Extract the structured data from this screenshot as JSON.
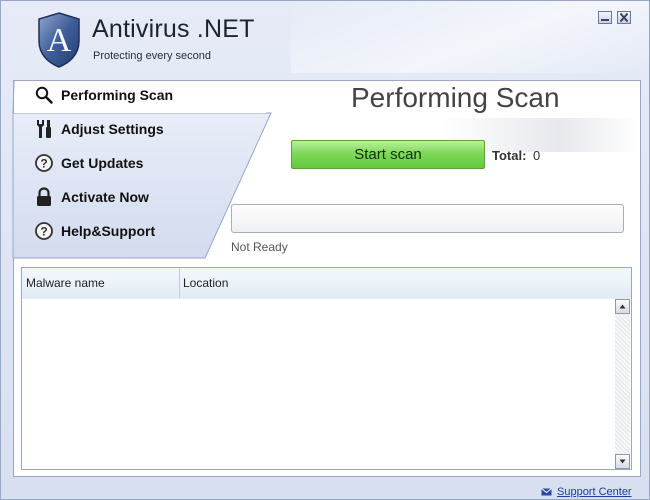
{
  "app": {
    "logo_letter": "A",
    "title": "Antivirus .NET",
    "subtitle": "Protecting every second"
  },
  "window_controls": {
    "minimize": "minimize-icon",
    "close": "close-icon"
  },
  "nav": {
    "active_index": 0,
    "items": [
      {
        "label": "Performing Scan",
        "icon": "search-icon"
      },
      {
        "label": "Adjust Settings",
        "icon": "tools-icon"
      },
      {
        "label": "Get Updates",
        "icon": "question-icon"
      },
      {
        "label": "Activate Now",
        "icon": "lock-icon"
      },
      {
        "label": "Help&Support",
        "icon": "question-icon"
      }
    ]
  },
  "scan": {
    "title": "Performing Scan",
    "start_button": "Start scan",
    "total_label": "Total:",
    "total_value": "0",
    "progress_percent": 0,
    "status": "Not Ready"
  },
  "table": {
    "columns": [
      "Malware name",
      "Location"
    ],
    "rows": []
  },
  "footer": {
    "support_label": "Support Center",
    "support_icon": "mail-icon"
  },
  "colors": {
    "accent_green": "#6cbf49",
    "link_blue": "#1c3f94",
    "nav_active_bg": "#ffffff"
  }
}
